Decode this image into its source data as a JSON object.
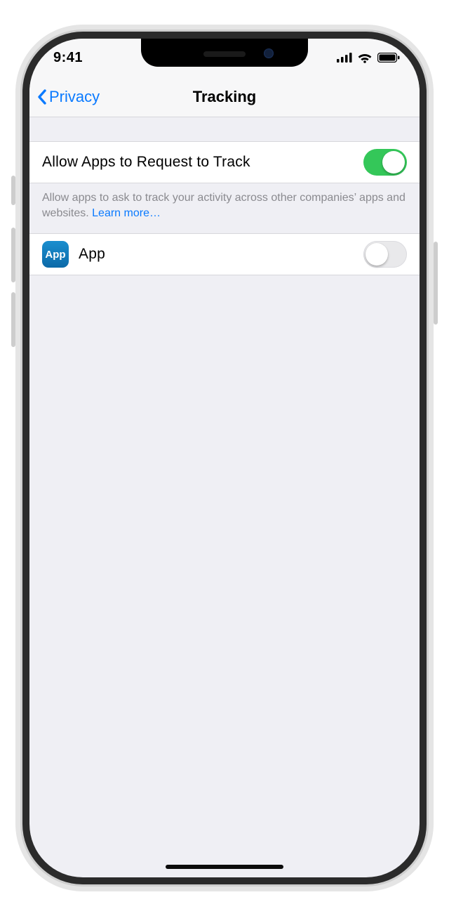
{
  "status": {
    "time": "9:41"
  },
  "nav": {
    "back_label": "Privacy",
    "title": "Tracking"
  },
  "master_toggle": {
    "label": "Allow Apps to Request to Track",
    "on": true
  },
  "footer": {
    "text": "Allow apps to ask to track your activity across other companies’ apps and websites. ",
    "link": "Learn more…"
  },
  "apps": [
    {
      "name": "App",
      "icon_text": "App",
      "on": false
    }
  ]
}
